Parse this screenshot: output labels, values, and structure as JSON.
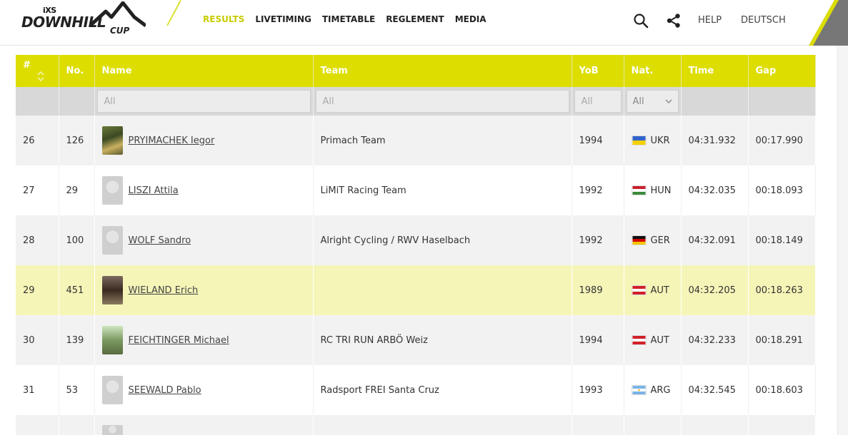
{
  "brand": {
    "logo_top": "iXS",
    "logo_main": "DOWNHILL",
    "logo_cup": "CUP"
  },
  "nav": {
    "items": [
      {
        "label": "RESULTS",
        "active": true
      },
      {
        "label": "LIVETIMING",
        "active": false
      },
      {
        "label": "TIMETABLE",
        "active": false
      },
      {
        "label": "REGLEMENT",
        "active": false
      },
      {
        "label": "MEDIA",
        "active": false
      }
    ],
    "help": "HELP",
    "language": "DEUTSCH"
  },
  "colors": {
    "accent": "#dddd00",
    "highlight_row": "#f5f5b8"
  },
  "table": {
    "headers": [
      "#",
      "No.",
      "Name",
      "Team",
      "YoB",
      "Nat.",
      "Time",
      "Gap"
    ],
    "filters": {
      "name_placeholder": "All",
      "team_placeholder": "All",
      "yob_placeholder": "All",
      "nat_selected": "All"
    },
    "rows": [
      {
        "rank": "26",
        "no": "126",
        "name": "PRYIMACHEK Iegor",
        "team": "Primach Team",
        "yob": "1994",
        "nat": "UKR",
        "time": "04:31.932",
        "gap": "00:17.990",
        "avatar": "photo"
      },
      {
        "rank": "27",
        "no": "29",
        "name": "LISZI Attila",
        "team": "LiMiT Racing Team",
        "yob": "1992",
        "nat": "HUN",
        "time": "04:32.035",
        "gap": "00:18.093",
        "avatar": "blank"
      },
      {
        "rank": "28",
        "no": "100",
        "name": "WOLF Sandro",
        "team": "Alright Cycling / RWV Haselbach",
        "yob": "1992",
        "nat": "GER",
        "time": "04:32.091",
        "gap": "00:18.149",
        "avatar": "blank"
      },
      {
        "rank": "29",
        "no": "451",
        "name": "WIELAND Erich",
        "team": "",
        "yob": "1989",
        "nat": "AUT",
        "time": "04:32.205",
        "gap": "00:18.263",
        "avatar": "photo",
        "highlighted": true
      },
      {
        "rank": "30",
        "no": "139",
        "name": "FEICHTINGER Michael",
        "team": "RC TRI RUN ARBÖ Weiz",
        "yob": "1994",
        "nat": "AUT",
        "time": "04:32.233",
        "gap": "00:18.291",
        "avatar": "photo"
      },
      {
        "rank": "31",
        "no": "53",
        "name": "SEEWALD Pablo",
        "team": "Radsport FREI Santa Cruz",
        "yob": "1993",
        "nat": "ARG",
        "time": "04:32.545",
        "gap": "00:18.603",
        "avatar": "blank"
      }
    ]
  }
}
